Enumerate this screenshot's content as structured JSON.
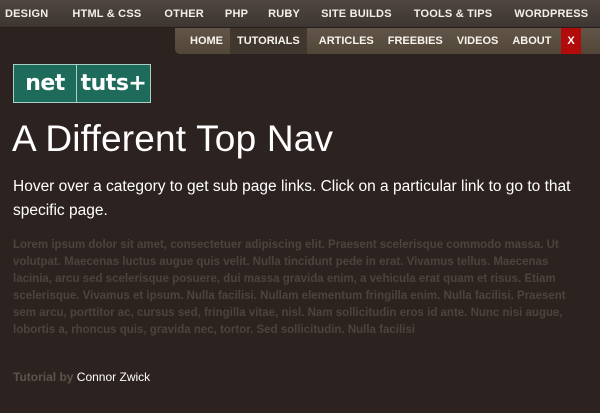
{
  "topnav": {
    "items": [
      "DESIGN",
      "HTML & CSS",
      "OTHER",
      "PHP",
      "RUBY",
      "SITE BUILDS",
      "TOOLS & TIPS",
      "WORDPRESS"
    ]
  },
  "subnav": {
    "items": [
      "HOME",
      "TUTORIALS",
      "ARTICLES",
      "FREEBIES",
      "VIDEOS",
      "ABOUT"
    ],
    "active": "TUTORIALS",
    "close_label": "X"
  },
  "logo": {
    "left": "net",
    "right": "tuts+"
  },
  "main": {
    "title": "A Different Top Nav",
    "subtitle": "Hover over a category to get sub page links. Click on a particular link to go to that specific page.",
    "body": "Lorem ipsum dolor sit amet, consectetuer adipiscing elit. Praesent scelerisque commodo massa. Ut volutpat. Maecenas luctus augue quis velit. Nulla tincidunt pede in erat. Vivamus tellus. Maecenas lacinia, arcu sed scelerisque posuere, dui massa gravida enim, a vehicula erat quam et risus. Etiam scelerisque. Vivamus et ipsum. Nulla facilisi. Nullam elementum fringilla enim. Nulla facilisi. Praesent sem arcu, porttitor ac, cursus sed, fringilla vitae, nisl. Nam sollicitudin eros id ante. Nunc nisi augue, lobortis a, rhoncus quis, gravida nec, tortor. Sed sollicitudin. Nulla facilisi"
  },
  "byline": {
    "prefix": "Tutorial by",
    "author": "Connor Zwick"
  }
}
